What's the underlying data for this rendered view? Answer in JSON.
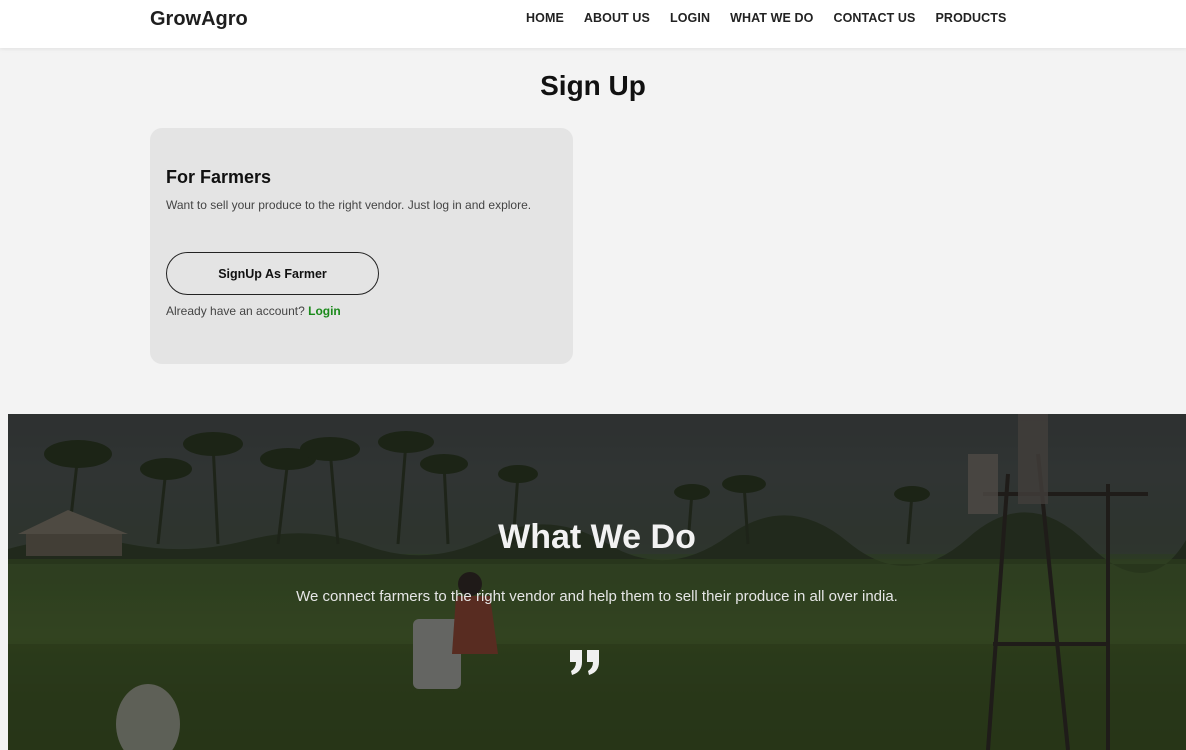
{
  "nav": {
    "brand": "GrowAgro",
    "links": [
      "HOME",
      "ABOUT US",
      "LOGIN",
      "WHAT WE DO",
      "CONTACT US",
      "PRODUCTS"
    ]
  },
  "signup": {
    "title": "Sign Up",
    "card": {
      "title": "For Farmers",
      "description": "Want to sell your produce to the right vendor. Just log in and explore.",
      "button_label": "SignUp As Farmer",
      "account_prompt": "Already have an account?",
      "login_link": "Login"
    }
  },
  "what_we_do": {
    "title": "What We Do",
    "text": "We connect farmers to the right vendor and help them to sell their produce in all over india.",
    "icon": "quote-icon"
  },
  "colors": {
    "accent_green": "#1b8a1b",
    "card_bg": "#e4e4e4",
    "page_bg": "#f3f3f3"
  }
}
